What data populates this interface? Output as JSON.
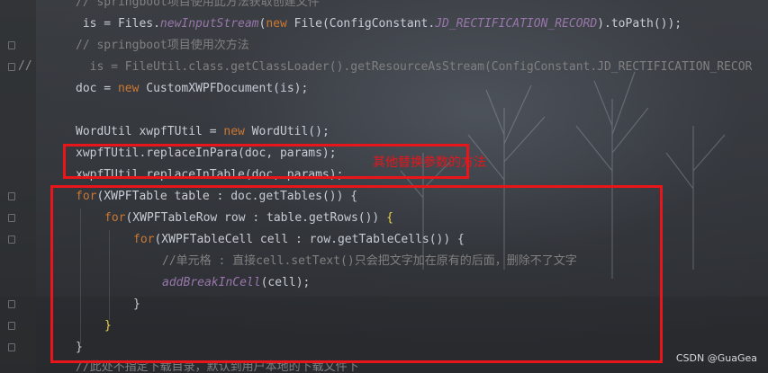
{
  "gutter": {
    "comment_marker": "//"
  },
  "code": {
    "line1": "// springboot项目使用此方法获取创建文件",
    "line2_a": " is = Files.",
    "line2_b": "newInputStream",
    "line2_c": "(",
    "line2_d": "new",
    "line2_e": " File(ConfigConstant.",
    "line2_f": "JD_RECTIFICATION_RECORD",
    "line2_g": ").toPath());",
    "line3": "// springboot项目使用次方法",
    "line4": "  is = FileUtil.class.getClassLoader().getResourceAsStream(ConfigConstant.JD_RECTIFICATION_RECOR",
    "line5_a": "doc = ",
    "line5_b": "new",
    "line5_c": " CustomXWPFDocument(is);",
    "line7_a": "WordUtil xwpfTUtil = ",
    "line7_b": "new",
    "line7_c": " WordUtil();",
    "line8": "xwpfTUtil.replaceInPara(doc, params);",
    "line9": "xwpfTUtil.replaceInTable(doc, params);",
    "line10_a": "for",
    "line10_b": "(XWPFTable table : doc.getTables()) {",
    "line11_a": "for",
    "line11_b": "(XWPFTableRow row : table.getRows()) ",
    "line11_c": "{",
    "line12_a": "for",
    "line12_b": "(XWPFTableCell cell : row.getTableCells()) {",
    "line13": "//单元格 : 直接cell.setText()只会把文字加在原有的后面，删除不了文字",
    "line14_a": "addBreakInCell",
    "line14_b": "(cell);",
    "line15": "}",
    "line16": "}",
    "line17": "}",
    "line18": "//此处不指定下载目录，默认到用户本地的下载文件下"
  },
  "annotation": {
    "text": "其他替换参数的方法",
    "color": "#e8151b"
  },
  "watermark": "CSDN @GuaGea"
}
